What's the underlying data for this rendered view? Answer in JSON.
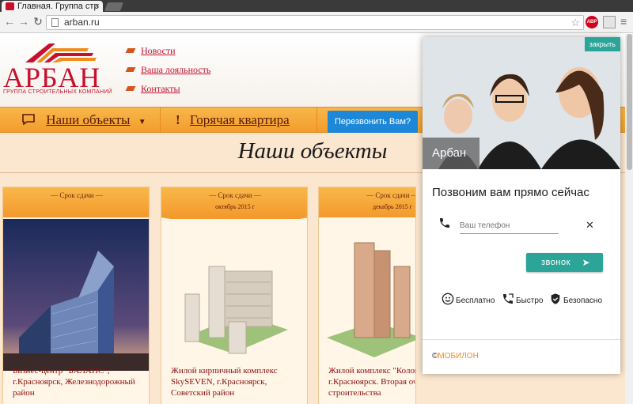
{
  "browser": {
    "tab_title": "Главная. Группа стр",
    "url": "arban.ru",
    "abp_label": "ABP"
  },
  "header": {
    "logo_text": "АРБАН",
    "logo_sub": "ГРУППА СТРОИТЕЛЬНЫХ КОМПАНИЙ",
    "links": [
      "Новости",
      "Ваша лояльность",
      "Контакты"
    ]
  },
  "nav": {
    "objects": "Наши объекты",
    "hot": "Горячая квартира",
    "callback": "Перезвонить Вам?"
  },
  "section_title": "Наши объекты",
  "cards": [
    {
      "deadline": "Срок сдачи",
      "date": "",
      "text": "Бизнес-центр \"БАЛАНС\", г.Красноярск, Железнодорожный район"
    },
    {
      "deadline": "Срок сдачи",
      "date": "октябрь 2015 г",
      "text": "Жилой кирпичный комплекс SkySEVEN, г.Красноярск, Советский район"
    },
    {
      "deadline": "Срок сдачи",
      "date": "декабрь 2015 г",
      "text": "Жилой комплекс \"Коломенский\", г.Красноярск. Вторая очередь строительства"
    }
  ],
  "widget": {
    "close": "закрыть",
    "brand": "Арбан",
    "title": "Позвоним вам прямо сейчас",
    "phone_placeholder": "Ваш телефон",
    "clear": "✕",
    "call_button": "звонок",
    "features": [
      "Бесплатно",
      "Быстро",
      "Безопасно"
    ],
    "footer_copy": "©",
    "footer_brand": "МОБИЛОН"
  }
}
